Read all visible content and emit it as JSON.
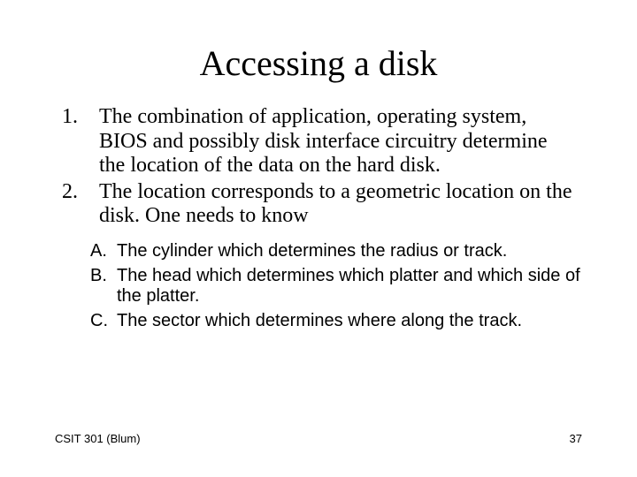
{
  "title": "Accessing a disk",
  "outer": [
    {
      "marker": "1.",
      "text": "The combination of application, operating system, BIOS and possibly disk interface circuitry determine the location of the data on the hard disk."
    },
    {
      "marker": "2.",
      "text": "The location corresponds to a geometric location on the disk.  One needs to know"
    }
  ],
  "inner": [
    {
      "marker": "A.",
      "text": "The cylinder which determines the radius or track."
    },
    {
      "marker": "B.",
      "text": "The head which determines which platter and which side of the platter."
    },
    {
      "marker": "C.",
      "text": "The sector which determines where along the track."
    }
  ],
  "footer": {
    "left": "CSIT 301 (Blum)",
    "right": "37"
  }
}
